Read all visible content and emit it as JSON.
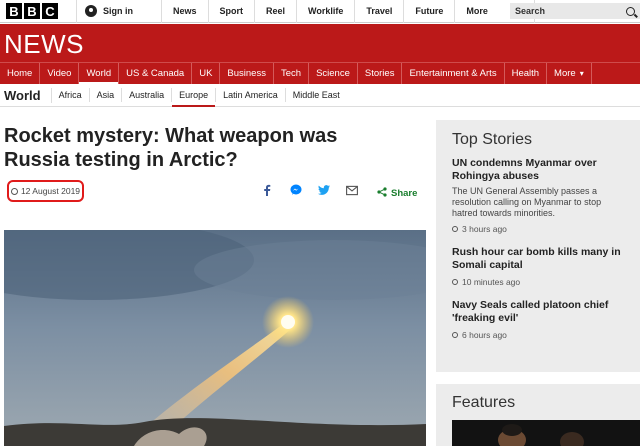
{
  "logo": [
    "B",
    "B",
    "C"
  ],
  "signin": {
    "label": "Sign in",
    "icon": "user-icon"
  },
  "top_nav": [
    "News",
    "Sport",
    "Reel",
    "Worklife",
    "Travel",
    "Future",
    "More"
  ],
  "search": {
    "placeholder": "Search",
    "icon": "search-icon"
  },
  "banner": {
    "title": "NEWS",
    "color": "#bb1919"
  },
  "main_nav": [
    "Home",
    "Video",
    "World",
    "US & Canada",
    "UK",
    "Business",
    "Tech",
    "Science",
    "Stories",
    "Entertainment & Arts",
    "Health",
    "More"
  ],
  "main_nav_active": "World",
  "world_nav": {
    "section": "World",
    "items": [
      "Africa",
      "Asia",
      "Australia",
      "Europe",
      "Latin America",
      "Middle East"
    ],
    "active": "Europe"
  },
  "article": {
    "headline": "Rocket mystery: What weapon was Russia testing in Arctic?",
    "date": "12 August 2019",
    "share_label": "Share",
    "share_icons": [
      "facebook-icon",
      "messenger-icon",
      "twitter-icon",
      "email-icon",
      "share-icon"
    ]
  },
  "top_stories": {
    "title": "Top Stories",
    "stories": [
      {
        "headline": "UN condemns Myanmar over Rohingya abuses",
        "summary": "The UN General Assembly passes a resolution calling on Myanmar to stop hatred towards minorities.",
        "time": "3 hours ago"
      },
      {
        "headline": "Rush hour car bomb kills many in Somali capital",
        "summary": "",
        "time": "10 minutes ago"
      },
      {
        "headline": "Navy Seals called platoon chief 'freaking evil'",
        "summary": "",
        "time": "6 hours ago"
      }
    ]
  },
  "features": {
    "title": "Features"
  },
  "colors": {
    "bbc_red": "#bb1919",
    "share_green": "#1a7e2e",
    "facebook": "#3b5998",
    "messenger": "#0084ff",
    "twitter": "#1da1f2",
    "highlight": "#e01b1b"
  }
}
